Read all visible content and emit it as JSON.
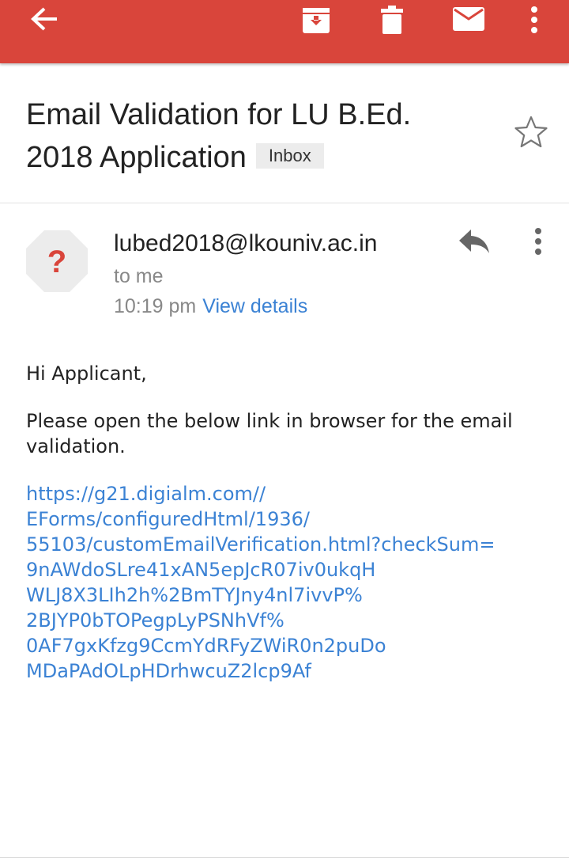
{
  "toolbar": {
    "back": "back-arrow-icon",
    "archive": "archive-icon",
    "delete": "trash-icon",
    "mark_unread": "mail-icon",
    "more": "more-vert-icon",
    "bar_color": "#d9453b"
  },
  "email": {
    "subject_line1": "Email Validation for LU B.Ed.",
    "subject_line2": "2018 Application",
    "label": "Inbox",
    "sender": "lubed2018@lkouniv.ac.in",
    "recipient": "to me",
    "time": "10:19 pm",
    "view_details": "View details",
    "greeting": "Hi Applicant,",
    "message": "Please open the below link in browser for the email validation.",
    "link_lines": [
      "https://g21.digialm.com//",
      "EForms/configuredHtml/1936/",
      "55103/customEmailVerification.html?checkSum=",
      "9nAWdoSLre41xAN5epJcR07iv0ukqH",
      "WLJ8X3LIh2h%2BmTYJny4nl7ivvP%",
      "2BJYP0bTOPegpLyPSNhVf%",
      "0AF7gxKfzg9CcmYdRFyZWiR0n2puDo",
      "MDaPAdOLpHDrhwcuZ2lcp9Af"
    ],
    "avatar_glyph": "?"
  },
  "colors": {
    "link": "#3b82d4",
    "avatar_bg": "#ececec",
    "avatar_glyph": "#d9453b"
  }
}
